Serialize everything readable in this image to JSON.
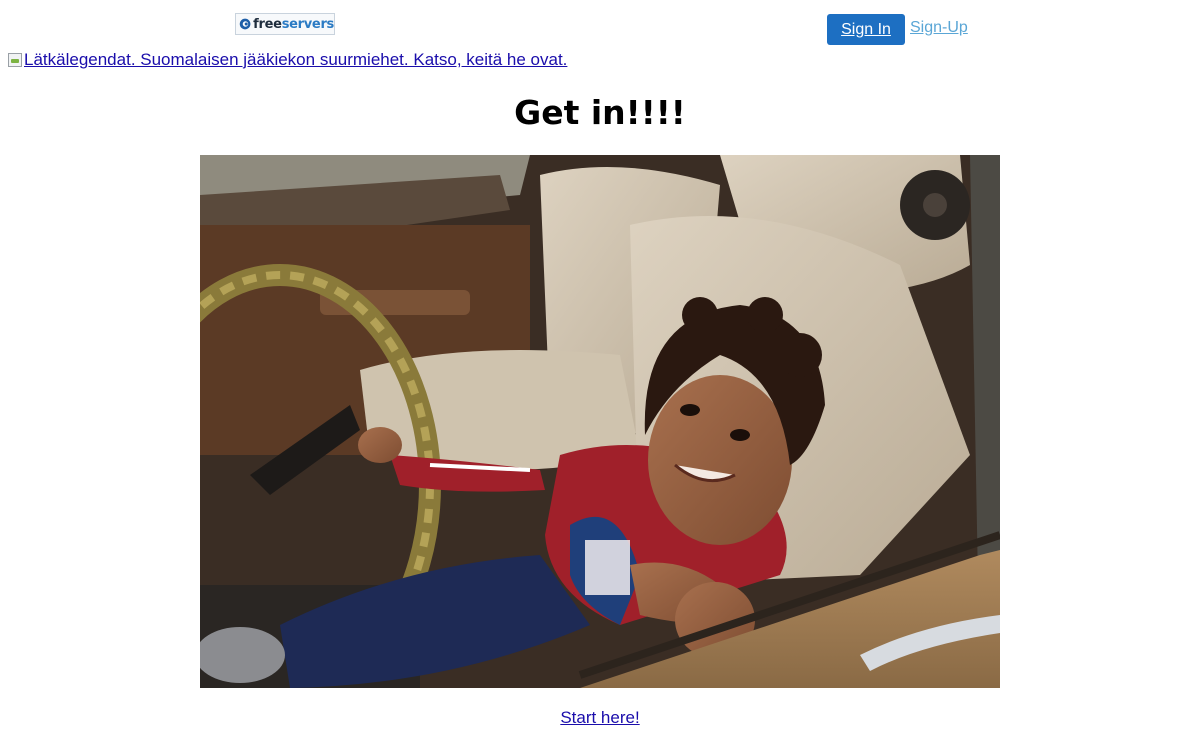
{
  "header": {
    "logo_part1": "free",
    "logo_part2": "servers",
    "signin_label": "Sign In",
    "signup_label": "Sign-Up"
  },
  "banner": {
    "alt_text": "Lätkälegendat. Suomalaisen jääkiekon suurmiehet. Katso, keitä he ovat."
  },
  "main": {
    "title": "Get in!!!!",
    "link_label": "Start here!"
  },
  "colors": {
    "signin_bg": "#1d6fc2",
    "signup_link": "#5aa6d6",
    "link": "#1a0dab"
  }
}
